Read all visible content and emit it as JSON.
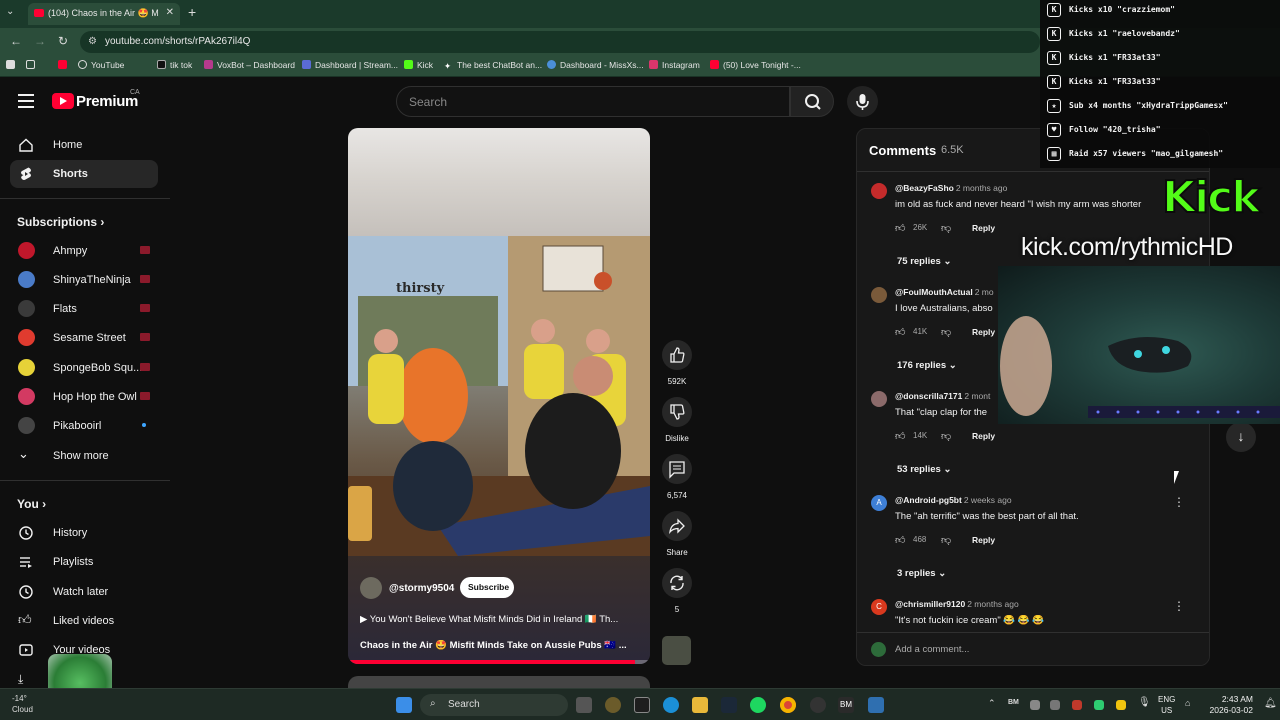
{
  "browser": {
    "tab_title": "(104) Chaos in the Air 🤩 M",
    "url": "youtube.com/shorts/rPAk267il4Q",
    "bookmarks": [
      "YouTube",
      "tik tok",
      "VoxBot – Dashboard",
      "Dashboard | Stream...",
      "Kick",
      "The best ChatBot an...",
      "Dashboard - MissXs...",
      "Instagram",
      "(50) Love Tonight -..."
    ]
  },
  "header": {
    "brand": "Premium",
    "region": "CA",
    "search_placeholder": "Search"
  },
  "sidebar": {
    "home": "Home",
    "shorts": "Shorts",
    "subscriptions_heading": "Subscriptions",
    "subscriptions": [
      {
        "name": "Ahmpy",
        "color": "#c0172b"
      },
      {
        "name": "ShinyaTheNinja",
        "color": "#4a7bc8"
      },
      {
        "name": "Flats",
        "color": "#3a3a3a"
      },
      {
        "name": "Sesame Street",
        "color": "#e03b2f"
      },
      {
        "name": "SpongeBob Squ...",
        "color": "#e6d238"
      },
      {
        "name": "Hop Hop the Owl",
        "color": "#d33a62"
      },
      {
        "name": "Pikabooirl",
        "color": "#444444"
      }
    ],
    "show_more": "Show more",
    "you_heading": "You",
    "you_items": [
      "History",
      "Playlists",
      "Watch later",
      "Liked videos",
      "Your videos"
    ]
  },
  "video": {
    "overlay_text": "thirsty",
    "channel": "@stormy9504",
    "subscribe": "Subscribe",
    "description": "▶ You Won't Believe What Misfit Minds Did in Ireland 🇮🇪 Th...",
    "title": "Chaos in the Air 🤩 Misfit Minds Take on Aussie Pubs 🇦🇺 ...",
    "progress": 0.95
  },
  "actions": {
    "likes": "592K",
    "dislike": "Dislike",
    "comments": "6,574",
    "share": "Share",
    "remix": "5"
  },
  "comments": {
    "title": "Comments",
    "count": "6.5K",
    "add_placeholder": "Add a comment...",
    "reply_label": "Reply",
    "items": [
      {
        "author": "@BeazyFaSho",
        "time": "2 months ago",
        "text": "im old as fuck and never heard \"I wish my arm was shorter",
        "likes": "26K",
        "replies": "75 replies",
        "avatar_color": "#c42b2b",
        "initial": ""
      },
      {
        "author": "@FoulMouthActual",
        "time": "2 mo",
        "text": "I love Australians, abso",
        "likes": "41K",
        "replies": "176 replies",
        "avatar_color": "#7a5a3a",
        "initial": ""
      },
      {
        "author": "@donscrilla7171",
        "time": "2 mont",
        "text": "That \"clap clap for the",
        "likes": "14K",
        "replies": "53 replies",
        "avatar_color": "#8b6a6a",
        "initial": ""
      },
      {
        "author": "@Android-pg5bt",
        "time": "2 weeks ago",
        "text": "The \"ah terrific\" was the best part of all that.",
        "likes": "468",
        "replies": "3 replies",
        "avatar_color": "#3e7fd6",
        "initial": "A"
      },
      {
        "author": "@chrismiller9120",
        "time": "2 months ago",
        "text": "\"It's not fuckin ice cream\" 😂 😂 😂",
        "likes": "",
        "replies": "",
        "avatar_color": "#d9391e",
        "initial": "C"
      }
    ]
  },
  "stream_overlay": {
    "alerts": [
      {
        "icon": "kick",
        "text": "Kicks x10 \"crazziemom\""
      },
      {
        "icon": "kick",
        "text": "Kicks x1 \"raelovebandz\""
      },
      {
        "icon": "kick",
        "text": "Kicks x1 \"FR33at33\""
      },
      {
        "icon": "kick",
        "text": "Kicks x1 \"FR33at33\""
      },
      {
        "icon": "star",
        "text": "Sub x4 months \"xHydraTrippGamesx\""
      },
      {
        "icon": "heart",
        "text": "Follow \"420_trisha\""
      },
      {
        "icon": "raid",
        "text": "Raid x57 viewers \"mao_gilgamesh\""
      }
    ],
    "kick_logo": "Kick",
    "kick_url": "kick.com/rythmicHD"
  },
  "taskbar": {
    "weather_temp": "-14°",
    "weather_label": "Cloud",
    "search": "Search",
    "lang_top": "ENG",
    "lang_bottom": "US",
    "time": "2:43 AM",
    "date": "2026-03-02",
    "tray_bm": "BM"
  }
}
